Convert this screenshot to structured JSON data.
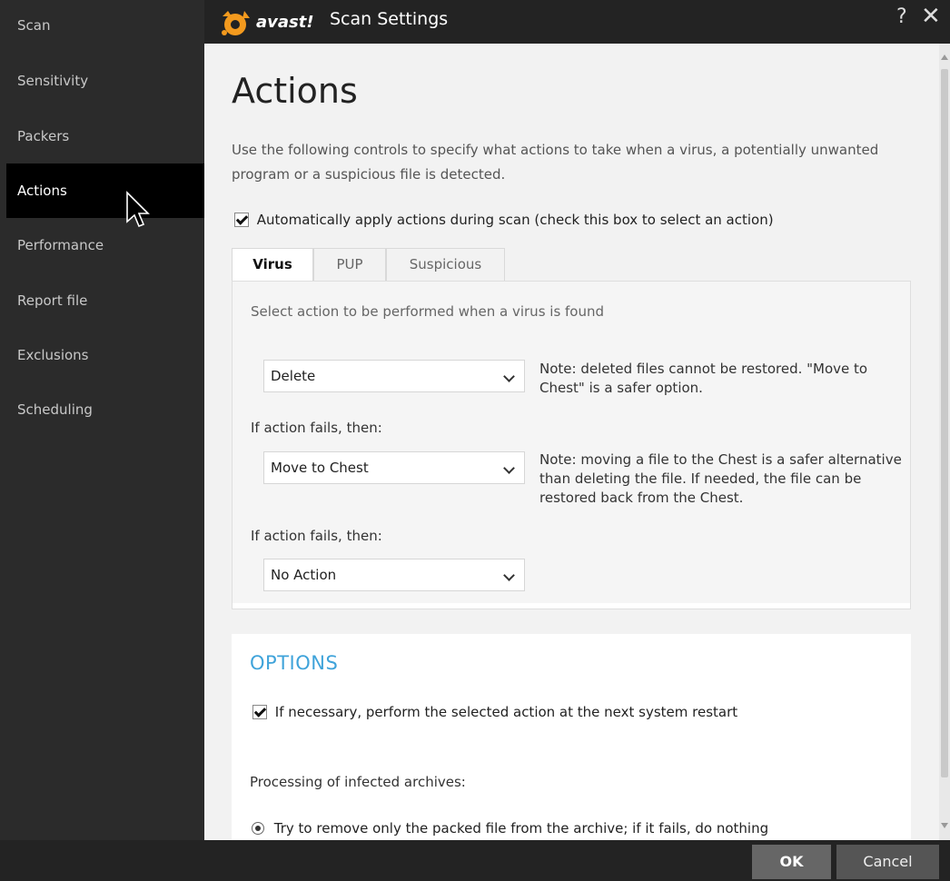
{
  "sidebar": {
    "items": [
      {
        "label": "Scan"
      },
      {
        "label": "Sensitivity"
      },
      {
        "label": "Packers"
      },
      {
        "label": "Actions"
      },
      {
        "label": "Performance"
      },
      {
        "label": "Report file"
      },
      {
        "label": "Exclusions"
      },
      {
        "label": "Scheduling"
      }
    ],
    "active": "Actions"
  },
  "titlebar": {
    "logo_text": "avast!",
    "title": "Scan Settings",
    "help": "?",
    "close": "✕"
  },
  "main": {
    "title": "Actions",
    "description": "Use the following controls to specify what actions to take when a virus, a potentially unwanted program or a suspicious file is detected.",
    "auto_apply": {
      "label": "Automatically apply actions during scan (check this box to select an action)",
      "checked": true
    },
    "tabs": [
      {
        "label": "Virus",
        "active": true
      },
      {
        "label": "PUP",
        "active": false
      },
      {
        "label": "Suspicious",
        "active": false
      }
    ],
    "panel": {
      "label": "Select action to be performed when a virus is found",
      "action1": {
        "value": "Delete",
        "note": "Note: deleted files cannot be restored. \"Move to Chest\" is a safer option."
      },
      "fail_label_1": "If action fails, then:",
      "action2": {
        "value": "Move to Chest",
        "note": "Note: moving a file to the Chest is a safer alternative than deleting the file. If needed, the file can be restored back from the Chest."
      },
      "fail_label_2": "If action fails, then:",
      "action3": {
        "value": "No Action"
      }
    },
    "options": {
      "title": "OPTIONS",
      "restart_check": {
        "label": "If necessary, perform the selected action at the next system restart",
        "checked": true
      },
      "archives_label": "Processing of infected archives:",
      "archive_radio": {
        "label": "Try to remove only the packed file from the archive; if it fails, do nothing",
        "selected": true
      }
    }
  },
  "footer": {
    "ok_label": "OK",
    "cancel_label": "Cancel"
  },
  "colors": {
    "accent_orange": "#f39a1e",
    "options_title": "#3fa3da",
    "sidebar_bg": "#2b2b2b",
    "active_item_bg": "#000000"
  }
}
